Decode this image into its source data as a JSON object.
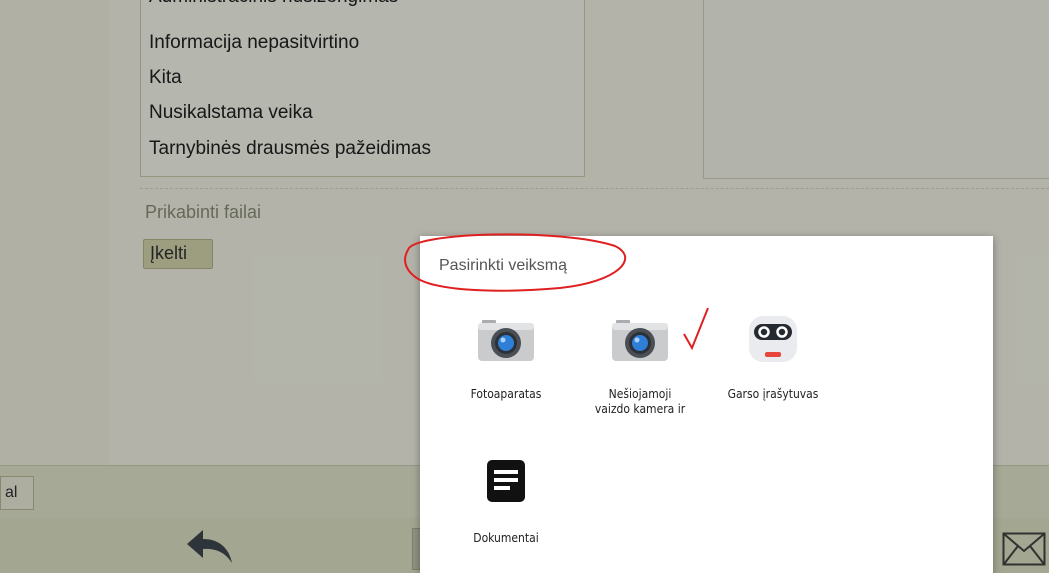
{
  "form": {
    "list_items": {
      "cut": "Administracinis nusižengimas",
      "i1": "Informacija nepasitvirtino",
      "i2": "Kita",
      "i3": "Nusikalstama veika",
      "i4": "Tarnybinės drausmės pažeidimas"
    },
    "attachments_label": "Prikabinti failai",
    "upload_button": "Įkelti"
  },
  "tab_stub": "al",
  "dialog": {
    "title": "Pasirinkti veiksmą",
    "apps": [
      {
        "label": "Fotoaparatas",
        "icon": "camera-icon"
      },
      {
        "label": "Nešiojamoji vaizdo kamera ir",
        "icon": "camera-icon"
      },
      {
        "label": "Garso įrašytuvas",
        "icon": "sound-recorder-icon"
      },
      {
        "label": "Dokumentai",
        "icon": "documents-icon"
      }
    ]
  },
  "colors": {
    "annotation": "#e02020",
    "page_background": "#f4f6e4",
    "button_background": "#d8dcb0",
    "camera_lens": "#2f7fd8"
  }
}
